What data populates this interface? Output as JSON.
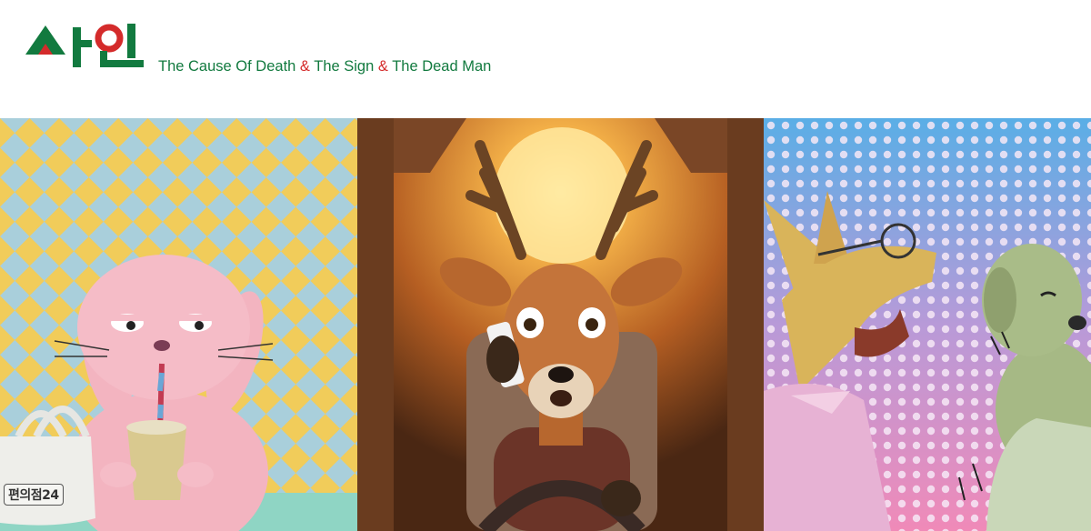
{
  "header": {
    "logo_text": "사인",
    "tagline": {
      "part1": "The Cause Of Death",
      "sep1": "&",
      "part2": "The Sign",
      "sep2": "&",
      "part3": "The Dead Man"
    }
  },
  "panels": {
    "rabbit": {
      "bag_label": "편의점24"
    }
  },
  "colors": {
    "brand_green": "#127a3f",
    "brand_red": "#d42b2b"
  },
  "icons": [
    "logo-mark",
    "bag-icon"
  ]
}
